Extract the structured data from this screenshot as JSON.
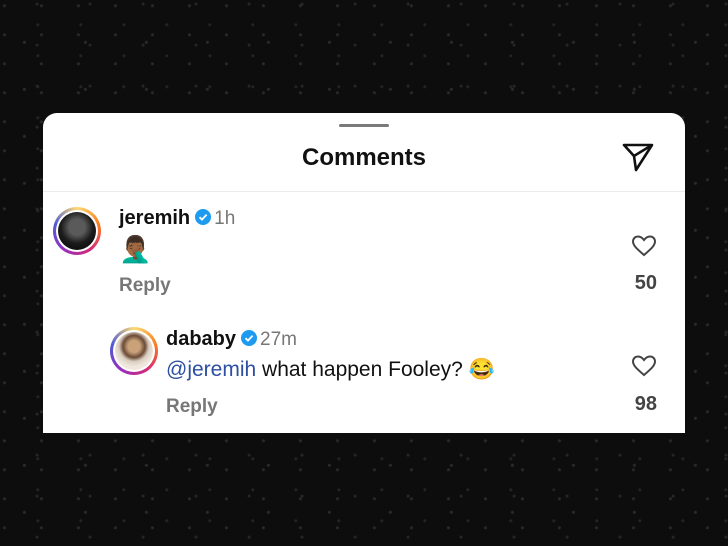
{
  "sheet": {
    "title": "Comments"
  },
  "comments": [
    {
      "username": "jeremih",
      "time": "1h",
      "emoji": "🤦🏾‍♂️",
      "reply_label": "Reply",
      "likes": "50"
    }
  ],
  "replies": [
    {
      "username": "dababy",
      "time": "27m",
      "mention": "@jeremih",
      "text": " what happen Fooley? ",
      "emoji": "😂",
      "reply_label": "Reply",
      "likes": "98"
    }
  ],
  "colors": {
    "mention": "#2d4fa0",
    "verified": "#1d9bf0"
  }
}
